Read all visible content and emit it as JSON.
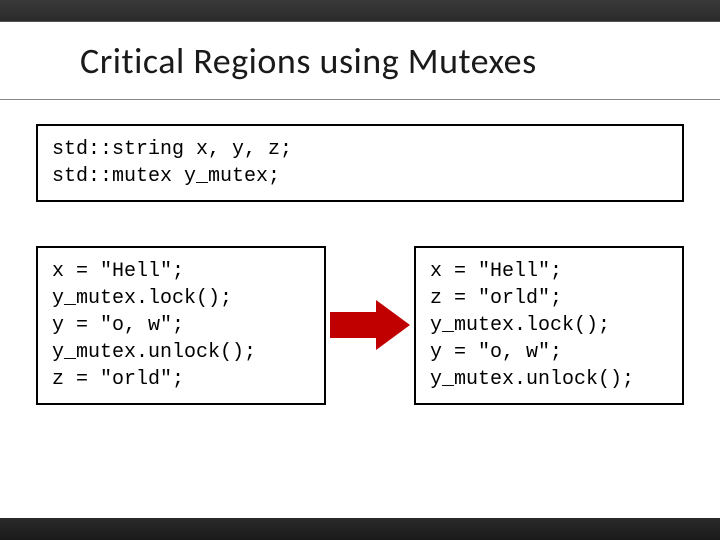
{
  "title": "Critical Regions using Mutexes",
  "decl": {
    "l1": "std::string x, y, z;",
    "l2": "std::mutex y_mutex;"
  },
  "left": {
    "l1": "x = \"Hell\";",
    "l2": "y_mutex.lock();",
    "l3": "y = \"o, w\";",
    "l4": "y_mutex.unlock();",
    "l5": "z = \"orld\";"
  },
  "right": {
    "l1": "x = \"Hell\";",
    "l2": "z = \"orld\";",
    "l3": "y_mutex.lock();",
    "l4": "y = \"o, w\";",
    "l5": "y_mutex.unlock();"
  }
}
